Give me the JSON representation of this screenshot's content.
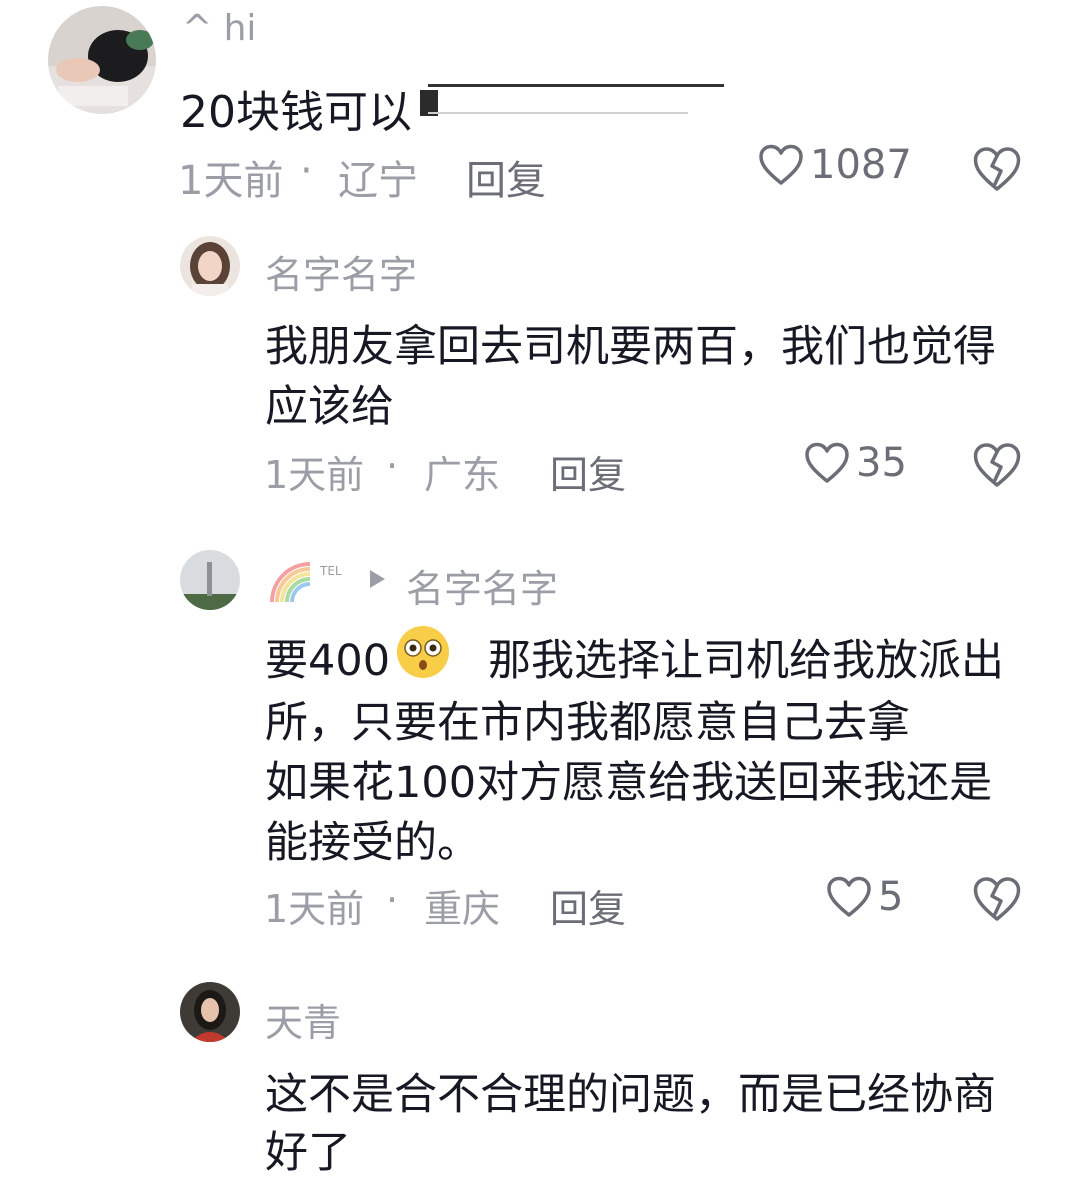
{
  "comments": [
    {
      "username": "^ hi",
      "text": "20块钱可以",
      "time": "1天前",
      "dot": "·",
      "location": "辽宁",
      "reply_label": "回复",
      "likes": "1087"
    },
    {
      "username": "名字名字",
      "text_line1": "我朋友拿回去司机要两百，我们也觉得",
      "text_line2": "应该给",
      "time": "1天前",
      "dot": "·",
      "location": "广东",
      "reply_label": "回复",
      "likes": "35"
    },
    {
      "reply_badge": "TEL",
      "username": "名字名字",
      "text_line1a": "要400",
      "text_line1b": "那我选择让司机给我放派出",
      "text_line2": "所，只要在市内我都愿意自己去拿",
      "text_line3": "如果花100对方愿意给我送回来我还是",
      "text_line4": "能接受的。",
      "time": "1天前",
      "dot": "·",
      "location": "重庆",
      "reply_label": "回复",
      "likes": "5"
    },
    {
      "username": "天青",
      "text_line1": "这不是合不合理的问题，而是已经协商",
      "text_line2": "好了"
    }
  ],
  "colors": {
    "text_primary": "#161823",
    "text_secondary": "#9b9ea6",
    "icon": "#6b6e76"
  },
  "icons": {
    "like": "heart-outline-icon",
    "dislike": "broken-heart-icon"
  }
}
